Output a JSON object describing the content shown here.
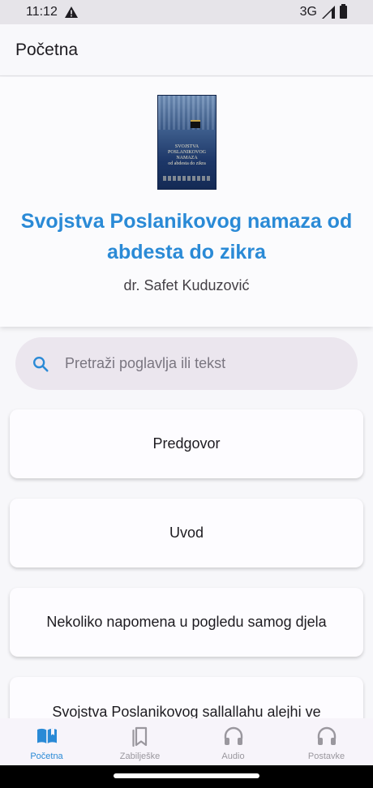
{
  "status": {
    "time": "11:12",
    "network": "3G"
  },
  "app_bar": {
    "title": "Početna"
  },
  "book": {
    "title": "Svojstva Poslanikovog namaza od abdesta do zikra",
    "author": "dr. Safet Kuduzović",
    "cover_lines": [
      "SVOJSTVA",
      "POSLANIKOVOG",
      "NAMAZA",
      "od abdesta do zikra"
    ]
  },
  "search": {
    "placeholder": "Pretraži poglavlja ili tekst",
    "value": ""
  },
  "chapters": [
    {
      "label": "Predgovor"
    },
    {
      "label": "Uvod"
    },
    {
      "label": "Nekoliko napomena u pogledu samog djela"
    },
    {
      "label": "Svojstva Poslanikovog sallallahu alejhi ve"
    }
  ],
  "nav": [
    {
      "label": "Početna",
      "icon": "book-open-icon",
      "active": true
    },
    {
      "label": "Zabilješke",
      "icon": "bookmarks-icon",
      "active": false
    },
    {
      "label": "Audio",
      "icon": "headphones-icon",
      "active": false
    },
    {
      "label": "Postavke",
      "icon": "headphones-icon",
      "active": false
    }
  ],
  "colors": {
    "accent": "#2a8ad6",
    "inactive": "#9a979e",
    "search_bg": "#ebe6ee"
  }
}
